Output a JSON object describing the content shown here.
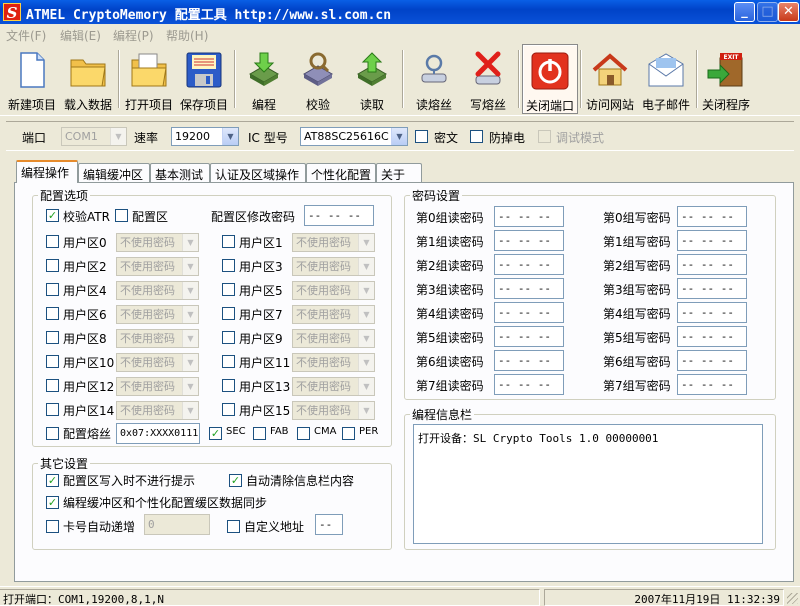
{
  "window": {
    "title": "ATMEL CryptoMemory 配置工具 http://www.sl.com.cn",
    "app_icon": "S"
  },
  "menu": [
    "文件(F)",
    "编辑(E)",
    "编程(P)",
    "帮助(H)"
  ],
  "toolbar": [
    {
      "label": "新建项目",
      "icon": "new-file-icon"
    },
    {
      "label": "载入数据",
      "icon": "folder-icon"
    },
    {
      "label": "打开项目",
      "icon": "open-folder-icon"
    },
    {
      "label": "保存项目",
      "icon": "floppy-disk-icon"
    },
    {
      "label": "编程",
      "icon": "chip-program-icon"
    },
    {
      "label": "校验",
      "icon": "chip-verify-icon"
    },
    {
      "label": "读取",
      "icon": "chip-read-icon"
    },
    {
      "label": "读熔丝",
      "icon": "fuse-read-icon"
    },
    {
      "label": "写熔丝",
      "icon": "fuse-write-icon"
    },
    {
      "label": "关闭端口",
      "icon": "power-icon"
    },
    {
      "label": "访问网站",
      "icon": "home-icon"
    },
    {
      "label": "电子邮件",
      "icon": "envelope-icon"
    },
    {
      "label": "关闭程序",
      "icon": "exit-door-icon"
    }
  ],
  "settings": {
    "port_label": "端口",
    "port_value": "COM1",
    "baud_label": "速率",
    "baud_value": "19200",
    "ic_label": "IC 型号",
    "ic_value": "AT88SC25616C",
    "cipher_label": "密文",
    "anti_pull_label": "防掉电",
    "debug_label": "调试模式"
  },
  "tabs": [
    "编程操作",
    "编辑缓冲区",
    "基本测试",
    "认证及区域操作",
    "个性化配置",
    "关于"
  ],
  "config": {
    "title": "配置选项",
    "verify_atr": "校验ATR",
    "config_zone": "配置区",
    "config_pw_label": "配置区修改密码",
    "config_pw_value": "-- -- --",
    "user_zones": [
      "用户区0",
      "用户区1",
      "用户区2",
      "用户区3",
      "用户区4",
      "用户区5",
      "用户区6",
      "用户区7",
      "用户区8",
      "用户区9",
      "用户区10",
      "用户区11",
      "用户区12",
      "用户区13",
      "用户区14",
      "用户区15"
    ],
    "no_password": "不使用密码",
    "fuse_label": "配置熔丝",
    "fuse_value": "0x07:XXXX0111",
    "fuses": [
      "SEC",
      "FAB",
      "CMA",
      "PER"
    ]
  },
  "passwords": {
    "title": "密码设置",
    "read": [
      "第0组读密码",
      "第1组读密码",
      "第2组读密码",
      "第3组读密码",
      "第4组读密码",
      "第5组读密码",
      "第6组读密码",
      "第7组读密码"
    ],
    "write": [
      "第0组写密码",
      "第1组写密码",
      "第2组写密码",
      "第3组写密码",
      "第4组写密码",
      "第5组写密码",
      "第6组写密码",
      "第7组写密码"
    ],
    "empty": "-- -- --"
  },
  "other": {
    "title": "其它设置",
    "opt1": "配置区写入时不进行提示",
    "opt2": "自动清除信息栏内容",
    "opt3": "编程缓冲区和个性化配置缓区数据同步",
    "opt4": "卡号自动递增",
    "card_value": "0",
    "opt5": "自定义地址",
    "addr_value": "--"
  },
  "info": {
    "title": "编程信息栏",
    "log": "打开设备：SL Crypto Tools 1.0 00000001"
  },
  "status": {
    "port": "打开端口：COM1,19200,8,1,N",
    "datetime": "2007年11月19日  11:32:39"
  }
}
